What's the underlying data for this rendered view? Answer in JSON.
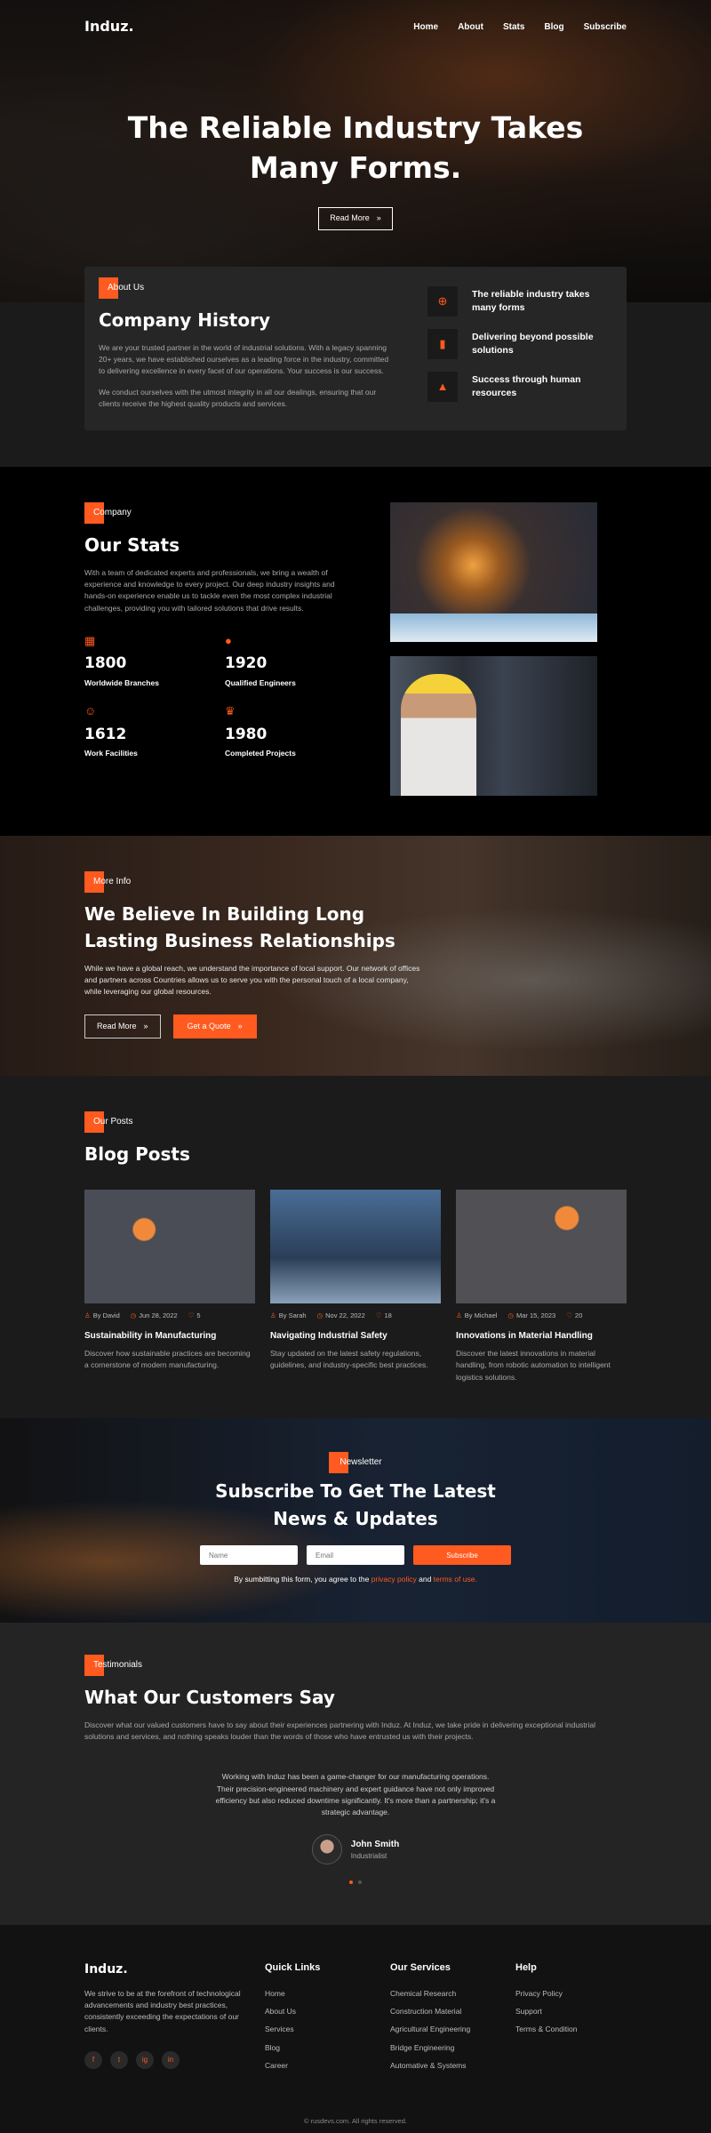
{
  "nav": {
    "logo": "Induz.",
    "items": [
      "Home",
      "About",
      "Stats",
      "Blog",
      "Subscribe"
    ]
  },
  "hero": {
    "title": "The Reliable Industry Takes Many Forms.",
    "button": "Read More"
  },
  "about": {
    "tag": "About Us",
    "title": "Company History",
    "p1": "We are your trusted partner in the world of industrial solutions. With a legacy spanning 20+ years, we have established ourselves as a leading force in the industry, committed to delivering excellence in every facet of our operations. Your success is our success.",
    "p2": "We conduct ourselves with the utmost integrity in all our dealings, ensuring that our clients receive the highest quality products and services.",
    "features": [
      {
        "icon": "globe-icon",
        "text": "The reliable industry takes many forms"
      },
      {
        "icon": "bar-chart-icon",
        "text": "Delivering beyond possible solutions"
      },
      {
        "icon": "thumbs-up-icon",
        "text": "Success through human resources"
      }
    ]
  },
  "stats": {
    "tag": "Company",
    "title": "Our Stats",
    "text": "With a team of dedicated experts and professionals, we bring a wealth of experience and knowledge to every project. Our deep industry insights and hands-on experience enable us to tackle even the most complex industrial challenges, providing you with tailored solutions that drive results.",
    "items": [
      {
        "icon": "building-icon",
        "value": "1800",
        "label": "Worldwide Branches"
      },
      {
        "icon": "user-icon",
        "value": "1920",
        "label": "Qualified Engineers"
      },
      {
        "icon": "smile-icon",
        "value": "1612",
        "label": "Work Facilities"
      },
      {
        "icon": "trophy-icon",
        "value": "1980",
        "label": "Completed Projects"
      }
    ]
  },
  "believe": {
    "tag": "More Info",
    "title": "We Believe In Building Long Lasting Business Relationships",
    "text": "While we have a global reach, we understand the importance of local support. Our network of offices and partners across Countries allows us to serve you with the personal touch of a local company, while leveraging our global resources.",
    "btn1": "Read More",
    "btn2": "Get a Quote"
  },
  "blog": {
    "tag": "Our Posts",
    "title": "Blog Posts",
    "posts": [
      {
        "author": "By David",
        "date": "Jun 28, 2022",
        "likes": "5",
        "title": "Sustainability in Manufacturing",
        "text": "Discover how sustainable practices are becoming a cornerstone of modern manufacturing."
      },
      {
        "author": "By Sarah",
        "date": "Nov 22, 2022",
        "likes": "18",
        "title": "Navigating Industrial Safety",
        "text": "Stay updated on the latest safety regulations, guidelines, and industry-specific best practices."
      },
      {
        "author": "By Michael",
        "date": "Mar 15, 2023",
        "likes": "20",
        "title": "Innovations in Material Handling",
        "text": "Discover the latest innovations in material handling, from robotic automation to intelligent logistics solutions."
      }
    ]
  },
  "newsletter": {
    "tag": "Newsletter",
    "title": "Subscribe To Get The Latest News & Updates",
    "name_ph": "Name",
    "email_ph": "Email",
    "button": "Subscribe",
    "agree_pre": "By sumbitting this form, you agree to the",
    "privacy": "privacy policy",
    "and": "and",
    "terms": "terms of use."
  },
  "testimonials": {
    "tag": "Testimonials",
    "title": "What Our Customers Say",
    "text": "Discover what our valued customers have to say about their experiences partnering with Induz. At Induz, we take pride in delivering exceptional industrial solutions and services, and nothing speaks louder than the words of those who have entrusted us with their projects.",
    "quote": "Working with Induz has been a game-changer for our manufacturing operations. Their precision-engineered machinery and expert guidance have not only improved efficiency but also reduced downtime significantly. It's more than a partnership; it's a strategic advantage.",
    "name": "John Smith",
    "role": "Industrialist"
  },
  "footer": {
    "logo": "Induz.",
    "desc": "We strive to be at the forefront of technological advancements and industry best practices, consistently exceeding the expectations of our clients.",
    "socials": [
      "f",
      "t",
      "ig",
      "in"
    ],
    "quick_title": "Quick Links",
    "quick": [
      "Home",
      "About Us",
      "Services",
      "Blog",
      "Career"
    ],
    "services_title": "Our Services",
    "services": [
      "Chemical Research",
      "Construction Material",
      "Agricultural Engineering",
      "Bridge Engineering",
      "Automative & Systems"
    ],
    "help_title": "Help",
    "help": [
      "Privacy Policy",
      "Support",
      "Terms & Condition"
    ],
    "copyright": "© rusdevs.com. All rights reserved."
  },
  "accent_color": "#ff5a1f"
}
